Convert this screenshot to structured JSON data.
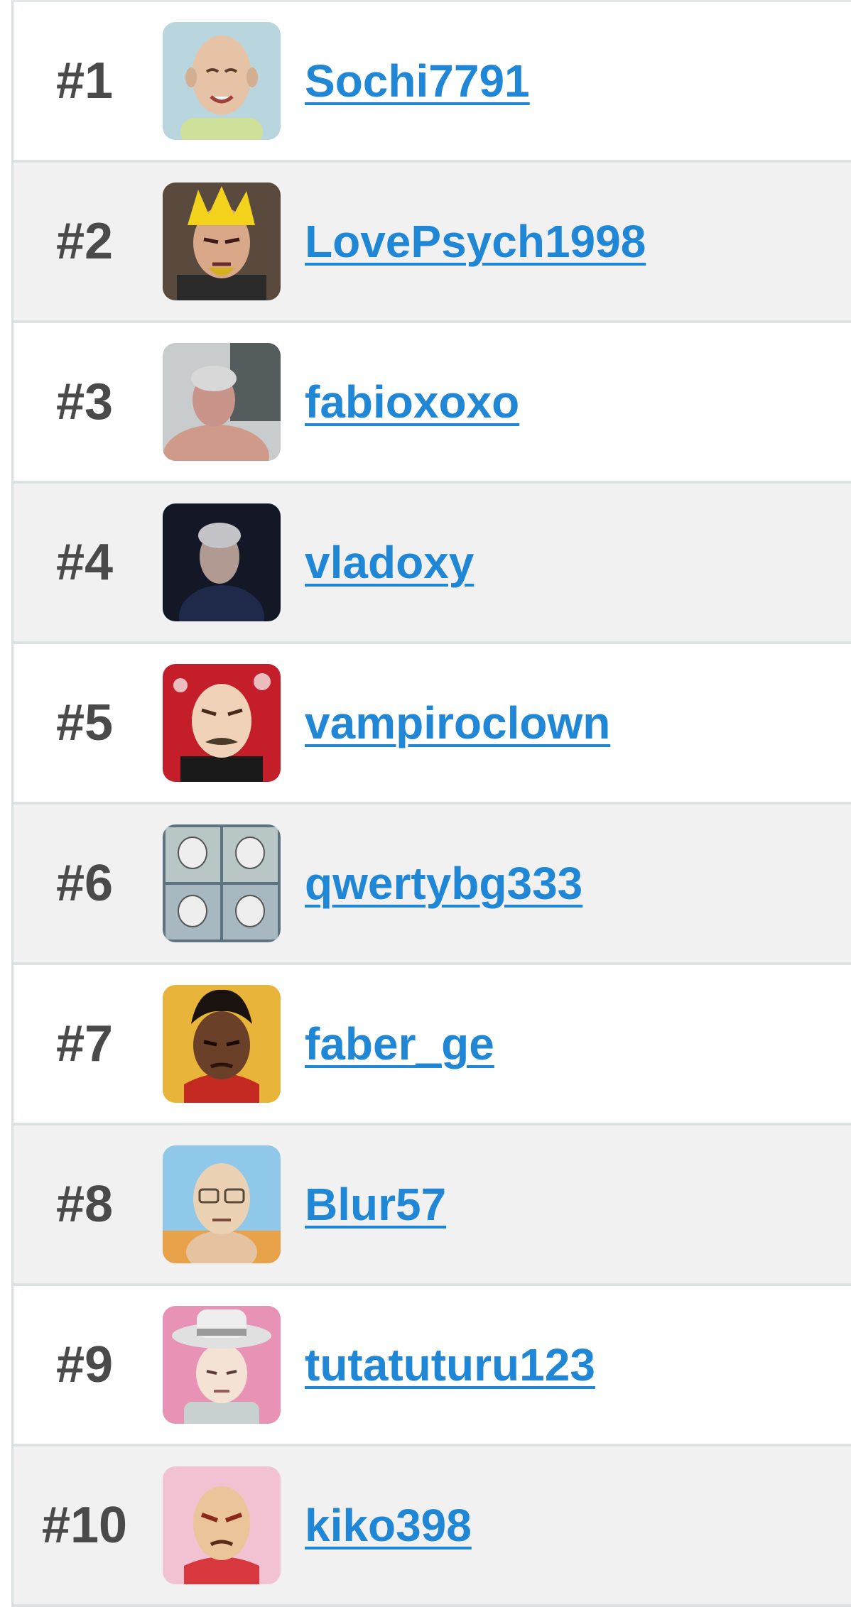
{
  "leaderboard": {
    "rows": [
      {
        "rank": "#1",
        "username": "Sochi7791",
        "avatar_icon": "cartoon-bald-smiling-avatar-icon",
        "avatar_bg": "#b9d6df"
      },
      {
        "rank": "#2",
        "username": "LovePsych1998",
        "avatar_icon": "cartoon-blond-spiky-hair-avatar-icon",
        "avatar_bg": "#5a4a3e"
      },
      {
        "rank": "#3",
        "username": "fabioxoxo",
        "avatar_icon": "photo-grey-haired-man-avatar-icon",
        "avatar_bg": "#9aa0a3"
      },
      {
        "rank": "#4",
        "username": "vladoxy",
        "avatar_icon": "photo-dark-portrait-avatar-icon",
        "avatar_bg": "#141726"
      },
      {
        "rank": "#5",
        "username": "vampiroclown",
        "avatar_icon": "cartoon-mustache-man-red-bg-avatar-icon",
        "avatar_bg": "#c41e2a"
      },
      {
        "rank": "#6",
        "username": "qwertybg333",
        "avatar_icon": "meme-faces-grid-avatar-icon",
        "avatar_bg": "#5d7380"
      },
      {
        "rank": "#7",
        "username": "faber_ge",
        "avatar_icon": "cartoon-dark-skin-yellow-bg-avatar-icon",
        "avatar_bg": "#e8b53a"
      },
      {
        "rank": "#8",
        "username": "Blur57",
        "avatar_icon": "cartoon-bald-glasses-beach-avatar-icon",
        "avatar_bg": "#8fc8e8"
      },
      {
        "rank": "#9",
        "username": "tutatuturu123",
        "avatar_icon": "cartoon-white-hat-pink-bg-avatar-icon",
        "avatar_bg": "#e892b6"
      },
      {
        "rank": "#10",
        "username": "kiko398",
        "avatar_icon": "cartoon-bald-angry-pink-bg-avatar-icon",
        "avatar_bg": "#f2c2d2"
      }
    ]
  },
  "colors": {
    "link": "#1f87d6",
    "rank_text": "#4a4a4a",
    "row_odd": "#ffffff",
    "row_even": "#f1f1f1",
    "divider": "#dde3e3"
  }
}
